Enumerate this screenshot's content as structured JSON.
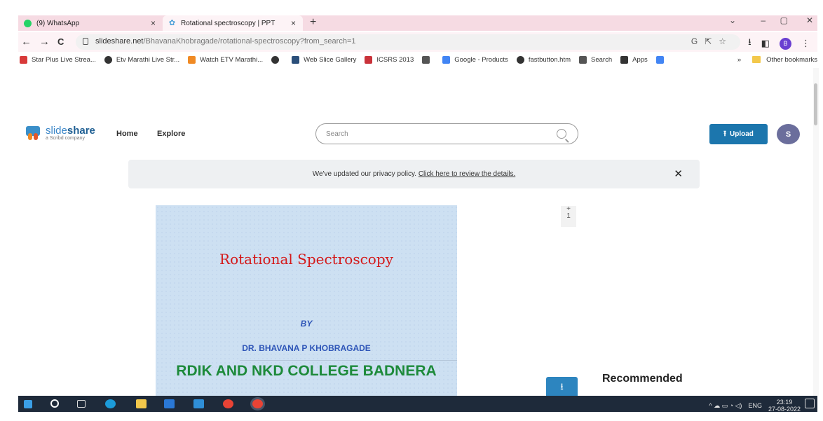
{
  "browser": {
    "tabs": [
      {
        "label": "(9) WhatsApp",
        "close": "×"
      },
      {
        "label": "Rotational spectroscopy | PPT",
        "close": "×"
      }
    ],
    "new_tab": "+",
    "window_controls": {
      "chevron": "⌄",
      "minimize": "–",
      "restore": "▢",
      "close": "✕"
    },
    "nav": {
      "back": "←",
      "forward": "→",
      "reload": "C"
    },
    "url_host": "slideshare.net",
    "url_path": "/BhavanaKhobragade/rotational-spectroscopy?from_search=1",
    "profile_initial": "B",
    "bookmarks": [
      {
        "label": "Star Plus Live Strea...",
        "color": "#d83a3a"
      },
      {
        "label": "Etv Marathi Live Str...",
        "color": "#333333"
      },
      {
        "label": "Watch ETV Marathi...",
        "color": "#f08a24"
      },
      {
        "label": "",
        "color": "#333333"
      },
      {
        "label": "Web Slice Gallery",
        "color": "#2b4f7a"
      },
      {
        "label": "ICSRS 2013",
        "color": "#c9323a"
      },
      {
        "label": "",
        "color": "#555555"
      },
      {
        "label": "Google - Products",
        "color": "#4285f4"
      },
      {
        "label": "fastbutton.htm",
        "color": "#333333"
      },
      {
        "label": "Search",
        "color": "#555555"
      },
      {
        "label": "Apps",
        "color": "#333333"
      },
      {
        "label": "",
        "color": "#4285f4"
      }
    ],
    "bookmarks_overflow": "»",
    "other_bookmarks": "Other bookmarks"
  },
  "site": {
    "brand_light": "slide",
    "brand_bold": "share",
    "brand_sub": "a Scribd company",
    "nav": {
      "home": "Home",
      "explore": "Explore"
    },
    "search_placeholder": "Search",
    "upload_icon": "⭱",
    "upload_label": "Upload",
    "avatar_initial": "S",
    "privacy_text": "We've updated our privacy policy. ",
    "privacy_link": "Click here to review the details.",
    "privacy_close": "✕"
  },
  "slide": {
    "title": "Rotational Spectroscopy",
    "by": "BY",
    "author": "DR.  BHAVANA P KHOBRAGADE",
    "college": "RDIK AND NKD COLLEGE BADNERA"
  },
  "sidebar": {
    "page_plus": "+",
    "page_number": "1",
    "download_icon": "⭳",
    "recommended": "Recommended"
  },
  "taskbar": {
    "lang": "ENG",
    "time": "23:19",
    "date": "27-08-2022",
    "tray_icons": "^ ☁ ▭ ◔ ◁)"
  }
}
